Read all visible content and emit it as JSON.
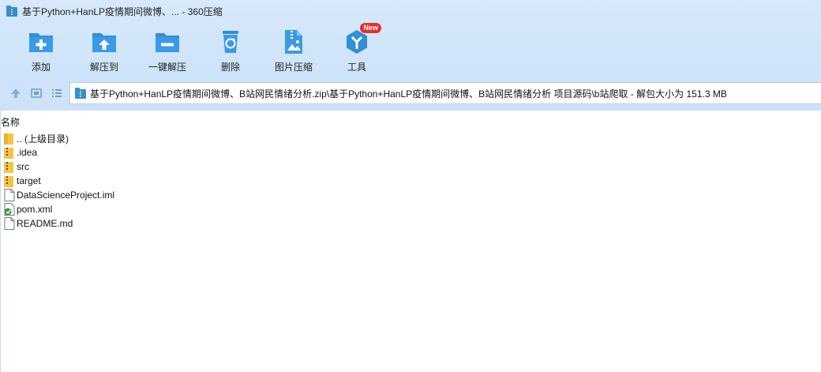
{
  "window": {
    "title": "基于Python+HanLP疫情期间微博、... - 360压缩"
  },
  "toolbar": {
    "items": [
      {
        "label": "添加",
        "icon": "add-folder-icon"
      },
      {
        "label": "解压到",
        "icon": "extract-to-icon"
      },
      {
        "label": "一键解压",
        "icon": "one-click-extract-icon"
      },
      {
        "label": "删除",
        "icon": "recycle-delete-icon"
      },
      {
        "label": "图片压缩",
        "icon": "image-compress-icon"
      },
      {
        "label": "工具",
        "icon": "tools-icon",
        "badge": "New"
      }
    ]
  },
  "nav": {
    "path": "基于Python+HanLP疫情期间微博、B站网民情绪分析.zip\\基于Python+HanLP疫情期间微博、B站网民情绪分析 项目源码\\b站爬取 - 解包大小为 151.3 MB"
  },
  "list": {
    "header_name": "名称",
    "files": [
      {
        "name": ".. (上级目录)",
        "type": "folder"
      },
      {
        "name": ".idea",
        "type": "folder"
      },
      {
        "name": "src",
        "type": "folder"
      },
      {
        "name": "target",
        "type": "folder"
      },
      {
        "name": "DataScienceProject.iml",
        "type": "file"
      },
      {
        "name": "pom.xml",
        "type": "xml"
      },
      {
        "name": "README.md",
        "type": "file"
      }
    ]
  },
  "colors": {
    "accent": "#2f8fd8",
    "band": "#d7e9fb",
    "badge": "#e5302c",
    "folder": "#f6c445"
  }
}
